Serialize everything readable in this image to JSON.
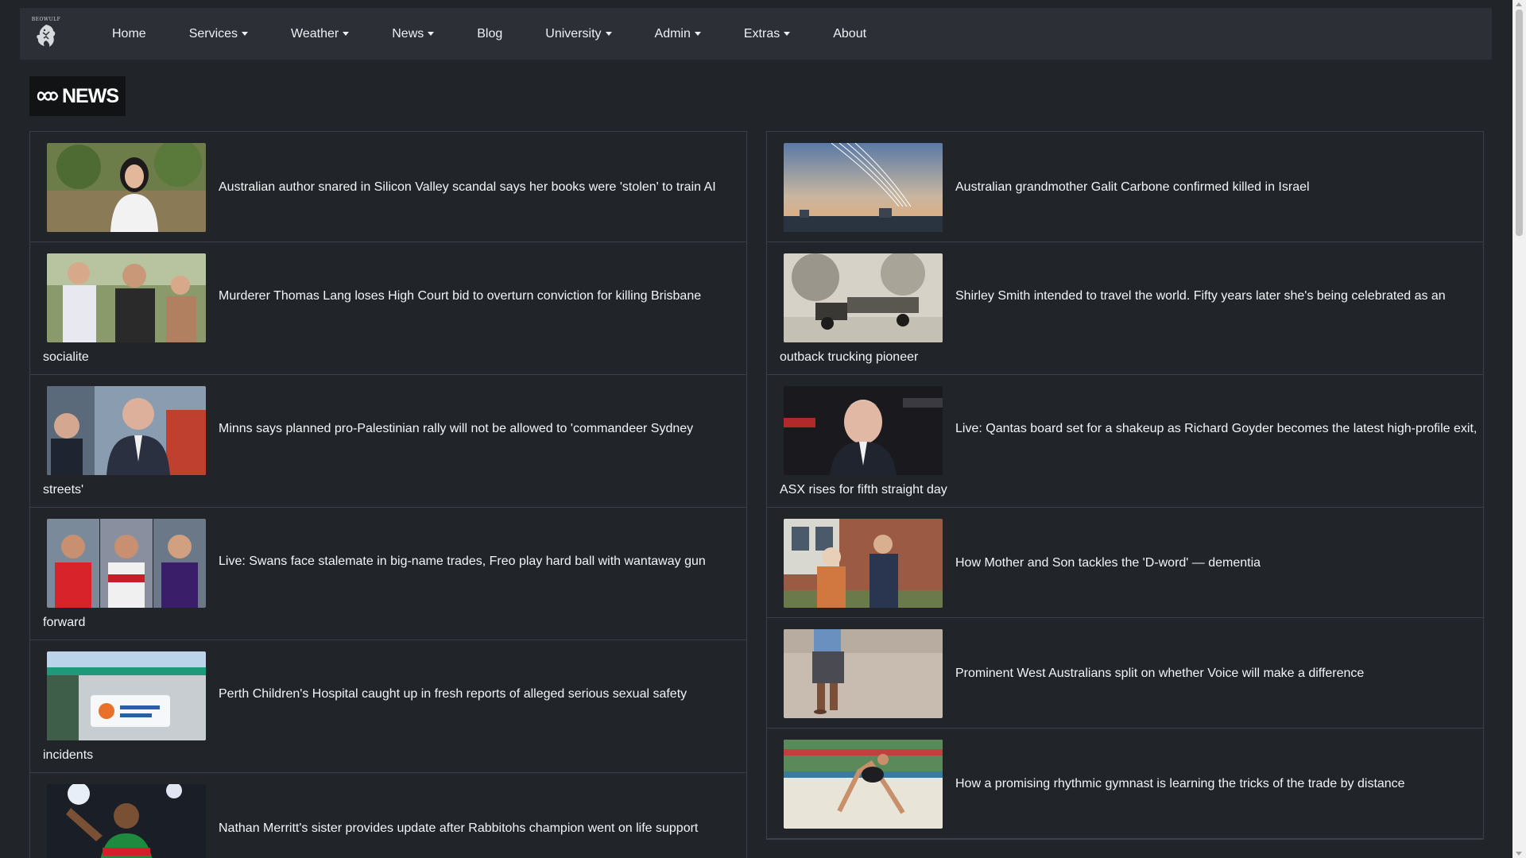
{
  "navbar": {
    "brand_text": "BEOWULF",
    "items": [
      {
        "label": "Home",
        "dropdown": false
      },
      {
        "label": "Services",
        "dropdown": true
      },
      {
        "label": "Weather",
        "dropdown": true
      },
      {
        "label": "News",
        "dropdown": true
      },
      {
        "label": "Blog",
        "dropdown": false
      },
      {
        "label": "University",
        "dropdown": true
      },
      {
        "label": "Admin",
        "dropdown": true
      },
      {
        "label": "Extras",
        "dropdown": true
      },
      {
        "label": "About",
        "dropdown": false
      }
    ]
  },
  "logo": {
    "text": "NEWS"
  },
  "left_articles": [
    {
      "line1": "Australian author snared in Silicon Valley scandal says her books were 'stolen' to train AI",
      "line2": "",
      "thumb": "woman-portrait"
    },
    {
      "line1": "Murderer Thomas Lang loses High Court bid to overturn conviction for killing Brisbane",
      "line2": "socialite",
      "thumb": "group-outdoors"
    },
    {
      "line1": "Minns says planned pro-Palestinian rally will not be allowed to 'commandeer Sydney",
      "line2": "streets'",
      "thumb": "politician"
    },
    {
      "line1": "Live: Swans face stalemate in big-name trades, Freo play hard ball with wantaway gun",
      "line2": "forward",
      "thumb": "afl-players"
    },
    {
      "line1": "Perth Children's Hospital caught up in fresh reports of alleged serious sexual safety",
      "line2": "incidents",
      "thumb": "hospital-building"
    },
    {
      "line1": "Nathan Merritt's sister provides update after Rabbitohs champion went on life support",
      "line2": "",
      "thumb": "rugby-player"
    }
  ],
  "right_articles": [
    {
      "line1": "Australian grandmother Galit Carbone confirmed killed in Israel",
      "line2": "",
      "thumb": "sky-rockets"
    },
    {
      "line1": "Shirley Smith intended to travel the world. Fifty years later she's being celebrated as an",
      "line2": "outback trucking pioneer",
      "thumb": "vintage-truck"
    },
    {
      "line1": "Live: Qantas board set for a shakeup as Richard Goyder becomes the latest high-profile exit,",
      "line2": "ASX rises for fifth straight day",
      "thumb": "executive-speaking"
    },
    {
      "line1": "How Mother and Son tackles the 'D-word' — dementia",
      "line2": "",
      "thumb": "mother-son"
    },
    {
      "line1": "Prominent West Australians split on whether Voice will make a difference",
      "line2": "",
      "thumb": "walking-feet"
    },
    {
      "line1": "How a promising rhythmic gymnast is learning the tricks of the trade by distance",
      "line2": "",
      "thumb": "gymnast"
    }
  ]
}
